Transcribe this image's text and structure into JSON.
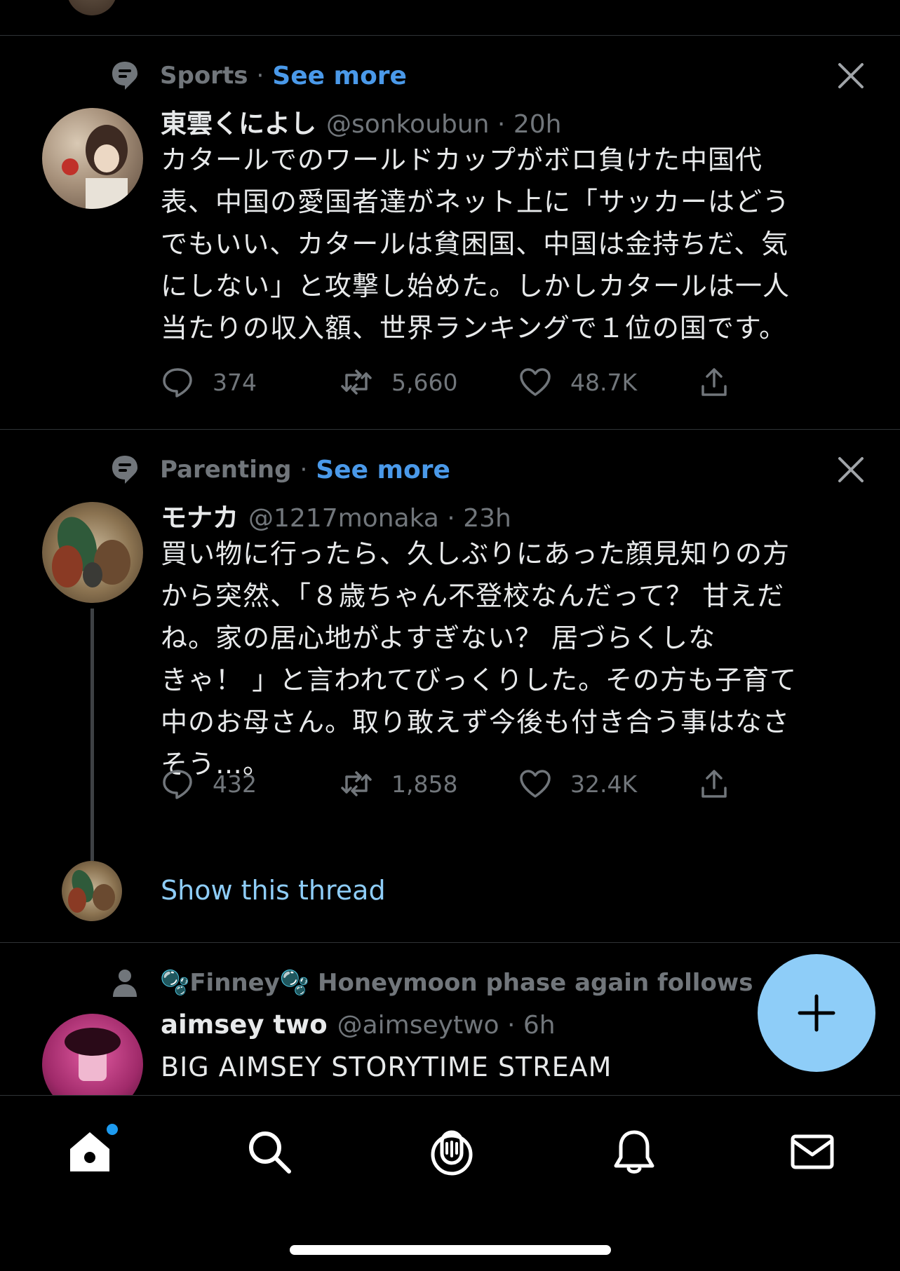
{
  "tweets": [
    {
      "context_topic": "Sports",
      "context_dot": "·",
      "context_more": "See more",
      "display_name": "東雲くによし",
      "handle_time": "@sonkoubun · 20h",
      "lines": [
        "カタールでのワールドカップがボロ負けた中国代",
        "表、中国の愛国者達がネット上に「サッカーはどう",
        "でもいい、カタールは貧困国、中国は金持ちだ、気",
        "にしない」と攻撃し始めた。しかしカタールは一人",
        "当たりの収入額、世界ランキングで１位の国です。"
      ],
      "replies": "374",
      "retweets": "5,660",
      "likes": "48.7K"
    },
    {
      "context_topic": "Parenting",
      "context_dot": "·",
      "context_more": "See more",
      "display_name": "モナカ",
      "handle_time": "@1217monaka · 23h",
      "lines": [
        "買い物に行ったら、久しぶりにあった顔見知りの方",
        "から突然、「８歳ちゃん不登校なんだって？ 甘えだ",
        "ね。家の居心地がよすぎない？ 居づらくしな",
        "きゃ！ 」と言われてびっくりした。その方も子育て",
        "中のお母さん。取り敢えず今後も付き合う事はなさ",
        "そう…。"
      ],
      "replies": "432",
      "retweets": "1,858",
      "likes": "32.4K",
      "show_thread": "Show this thread"
    },
    {
      "context_follow": "🫧Finney🫧 Honeymoon phase again follows",
      "display_name": "aimsey two",
      "handle_time": "@aimseytwo · 6h",
      "lines": [
        "BIG AIMSEY STORYTIME STREAM"
      ]
    }
  ],
  "icons": {
    "topic": "topic-icon",
    "close": "close-icon",
    "reply": "reply-icon",
    "retweet": "retweet-icon",
    "like": "like-icon",
    "share": "share-icon",
    "follow": "person-icon",
    "compose": "plus-icon"
  },
  "nav": [
    "home-icon",
    "search-icon",
    "spaces-icon",
    "notifications-icon",
    "messages-icon"
  ],
  "colors": {
    "accent": "#1d9bf0",
    "link": "#4a99e9",
    "fab": "#8ecdf8",
    "muted": "#71767b"
  }
}
